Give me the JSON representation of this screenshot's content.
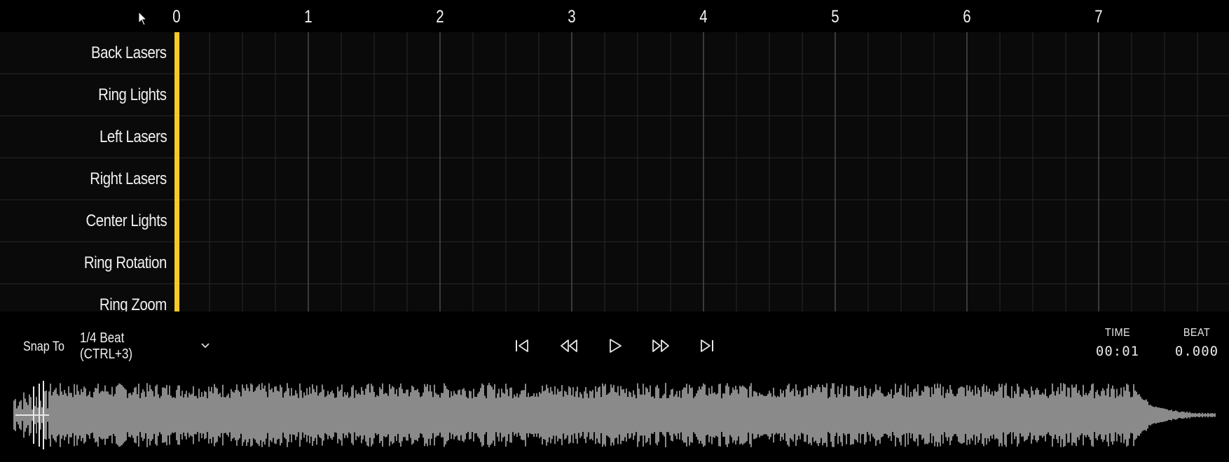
{
  "ruler": {
    "beats": [
      "0",
      "1",
      "2",
      "3",
      "4",
      "5",
      "6",
      "7"
    ]
  },
  "tracks": [
    {
      "label": "Back Lasers"
    },
    {
      "label": "Ring Lights"
    },
    {
      "label": "Left Lasers"
    },
    {
      "label": "Right Lasers"
    },
    {
      "label": "Center Lights"
    },
    {
      "label": "Ring Rotation"
    },
    {
      "label": "Ring Zoom"
    }
  ],
  "controls": {
    "snap_label": "Snap To",
    "snap_value": "1/4 Beat (CTRL+3)",
    "transport": [
      {
        "name": "skip-to-start-icon"
      },
      {
        "name": "rewind-icon"
      },
      {
        "name": "play-icon"
      },
      {
        "name": "fast-forward-icon"
      },
      {
        "name": "skip-to-end-icon"
      }
    ],
    "time_label": "TIME",
    "time_value": "00:01",
    "beat_label": "BEAT",
    "beat_value": "0.000"
  },
  "colors": {
    "playhead": "#f6c928",
    "background": "#000000",
    "waveform": "#8a8a8a"
  }
}
